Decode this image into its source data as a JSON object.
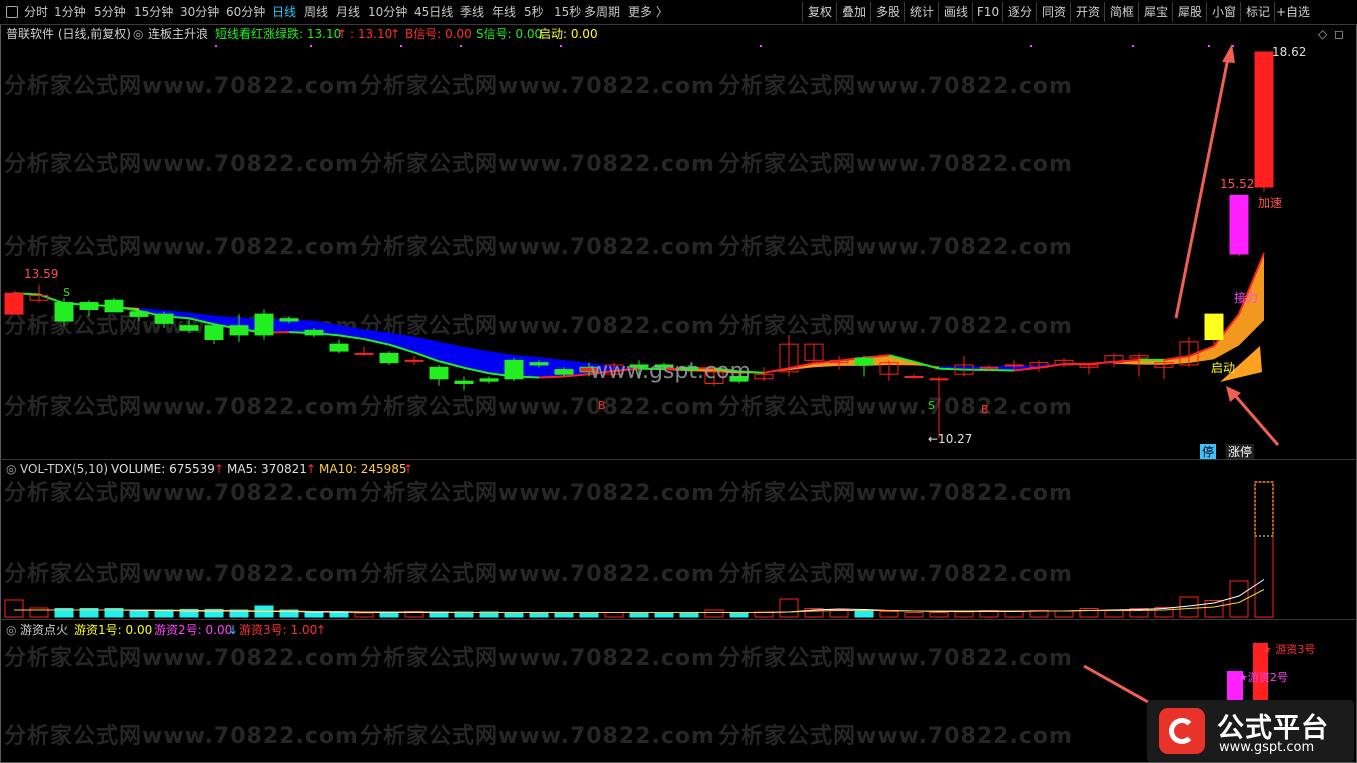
{
  "toolbar": {
    "periods": [
      "分时",
      "1分钟",
      "5分钟",
      "15分钟",
      "30分钟",
      "60分钟",
      "日线",
      "周线",
      "月线",
      "10分钟",
      "45日线",
      "季线",
      "年线",
      "5秒",
      "15秒",
      "多周期",
      "更多 〉"
    ],
    "active_period": "日线",
    "right_buttons": [
      "复权",
      "叠加",
      "多股",
      "统计",
      "画线",
      "F10",
      "逐分",
      "同资",
      "开资",
      "简框",
      "犀宝",
      "犀股",
      "小窗",
      "标记",
      "+自选"
    ]
  },
  "main_header": {
    "title": "普联软件 (日线,前复权)",
    "indicator": "连板主升浪",
    "item1_label": "短线看红涨绿跌: 13.10",
    "item2_label": ": 13.10",
    "b_signal": "B信号: 0.00",
    "s_signal": "S信号: 0.00",
    "start": "启动: 0.00"
  },
  "vol_header": {
    "name": "VOL-TDX(5,10)",
    "volume": "VOLUME: 675539",
    "ma5": "MA5: 370821",
    "ma10": "MA10: 245985"
  },
  "yz_header": {
    "name": "游资点火",
    "y1": "游资1号: 0.00",
    "y2": "游资2号: 0.00",
    "y3": "游资3号: 1.00"
  },
  "annotations": {
    "high_left": "13.59",
    "high_right": "18.62",
    "mid_price": "15.52",
    "low_price": "←10.27",
    "jiasu": "加速",
    "jieli": "接力",
    "qidong": "启动",
    "ting": "停",
    "zhangting": "涨停",
    "center_watermark": "www.gspt.com",
    "yz3_label": "★ 游资3号",
    "yz2_label": "★游资2号",
    "sig_s": "S",
    "sig_b": "B"
  },
  "watermark_text": "分析家公式网www.70822.com",
  "logo": {
    "name": "公式平台",
    "url": "www.gspt.com"
  },
  "colors": {
    "up": "#ff2020",
    "down": "#22ee22",
    "vol_down": "#20f0f0",
    "blue_band": "#0000ff",
    "orange_band": "#ffa020",
    "yellow": "#ffff20",
    "magenta": "#ff20ff",
    "accent": "#20c8ff"
  },
  "chart_data": {
    "type": "candlestick",
    "price_range": [
      10.27,
      18.62
    ],
    "candles": [
      {
        "o": 12.95,
        "h": 13.45,
        "l": 12.95,
        "c": 13.4
      },
      {
        "o": 13.25,
        "h": 13.59,
        "l": 13.2,
        "c": 13.35
      },
      {
        "o": 13.2,
        "h": 13.3,
        "l": 12.7,
        "c": 12.8
      },
      {
        "o": 13.2,
        "h": 13.25,
        "l": 12.9,
        "c": 13.05
      },
      {
        "o": 13.25,
        "h": 13.3,
        "l": 13.0,
        "c": 13.0
      },
      {
        "o": 13.0,
        "h": 13.05,
        "l": 12.8,
        "c": 12.9
      },
      {
        "o": 12.95,
        "h": 13.0,
        "l": 12.65,
        "c": 12.75
      },
      {
        "o": 12.7,
        "h": 12.85,
        "l": 12.55,
        "c": 12.6
      },
      {
        "o": 12.7,
        "h": 12.75,
        "l": 12.3,
        "c": 12.4
      },
      {
        "o": 12.7,
        "h": 12.95,
        "l": 12.35,
        "c": 12.5
      },
      {
        "o": 12.95,
        "h": 13.05,
        "l": 12.4,
        "c": 12.5
      },
      {
        "o": 12.85,
        "h": 12.9,
        "l": 12.75,
        "c": 12.8
      },
      {
        "o": 12.6,
        "h": 12.65,
        "l": 12.45,
        "c": 12.5
      },
      {
        "o": 12.3,
        "h": 12.4,
        "l": 12.1,
        "c": 12.15
      },
      {
        "o": 12.1,
        "h": 12.25,
        "l": 12.05,
        "c": 12.1
      },
      {
        "o": 12.1,
        "h": 12.15,
        "l": 11.85,
        "c": 11.9
      },
      {
        "o": 11.95,
        "h": 12.05,
        "l": 11.85,
        "c": 11.95
      },
      {
        "o": 11.8,
        "h": 11.85,
        "l": 11.4,
        "c": 11.55
      },
      {
        "o": 11.5,
        "h": 11.6,
        "l": 11.3,
        "c": 11.45
      },
      {
        "o": 11.55,
        "h": 11.6,
        "l": 11.45,
        "c": 11.5
      },
      {
        "o": 11.95,
        "h": 12.0,
        "l": 11.5,
        "c": 11.55
      },
      {
        "o": 11.9,
        "h": 11.95,
        "l": 11.8,
        "c": 11.85
      },
      {
        "o": 11.75,
        "h": 11.8,
        "l": 11.6,
        "c": 11.65
      },
      {
        "o": 11.8,
        "h": 11.9,
        "l": 11.6,
        "c": 11.7
      },
      {
        "o": 11.65,
        "h": 11.9,
        "l": 11.6,
        "c": 11.85
      },
      {
        "o": 11.85,
        "h": 11.95,
        "l": 11.55,
        "c": 11.8
      },
      {
        "o": 11.85,
        "h": 11.9,
        "l": 11.75,
        "c": 11.8
      },
      {
        "o": 11.8,
        "h": 11.85,
        "l": 11.7,
        "c": 11.75
      },
      {
        "o": 11.45,
        "h": 11.75,
        "l": 11.4,
        "c": 11.7
      },
      {
        "o": 11.6,
        "h": 11.65,
        "l": 11.45,
        "c": 11.5
      },
      {
        "o": 11.55,
        "h": 11.8,
        "l": 11.5,
        "c": 11.65
      },
      {
        "o": 11.7,
        "h": 12.5,
        "l": 11.6,
        "c": 12.3
      },
      {
        "o": 11.95,
        "h": 12.3,
        "l": 11.9,
        "c": 12.3
      },
      {
        "o": 11.9,
        "h": 12.05,
        "l": 11.75,
        "c": 11.95
      },
      {
        "o": 12.0,
        "h": 12.05,
        "l": 11.6,
        "c": 11.85
      },
      {
        "o": 11.65,
        "h": 11.95,
        "l": 11.5,
        "c": 11.9
      },
      {
        "o": 11.6,
        "h": 11.65,
        "l": 11.55,
        "c": 11.6
      },
      {
        "o": 11.55,
        "h": 11.6,
        "l": 10.27,
        "c": 11.55
      },
      {
        "o": 11.65,
        "h": 12.05,
        "l": 11.6,
        "c": 11.85
      },
      {
        "o": 11.8,
        "h": 11.85,
        "l": 11.7,
        "c": 11.8
      },
      {
        "o": 11.85,
        "h": 11.95,
        "l": 11.75,
        "c": 11.85
      },
      {
        "o": 11.8,
        "h": 11.95,
        "l": 11.7,
        "c": 11.9
      },
      {
        "o": 11.85,
        "h": 12.0,
        "l": 11.8,
        "c": 11.95
      },
      {
        "o": 11.8,
        "h": 11.9,
        "l": 11.65,
        "c": 11.85
      },
      {
        "o": 11.9,
        "h": 12.1,
        "l": 11.8,
        "c": 12.05
      },
      {
        "o": 12.0,
        "h": 12.1,
        "l": 11.6,
        "c": 12.05
      },
      {
        "o": 11.8,
        "h": 11.95,
        "l": 11.55,
        "c": 11.9
      },
      {
        "o": 11.85,
        "h": 12.45,
        "l": 11.8,
        "c": 12.35
      },
      {
        "o": 12.4,
        "h": 12.95,
        "l": 12.3,
        "c": 12.95
      },
      {
        "o": 14.25,
        "h": 15.52,
        "l": 14.2,
        "c": 15.52
      },
      {
        "o": 15.7,
        "h": 18.62,
        "l": 15.6,
        "c": 18.62
      }
    ],
    "volumes": [
      34,
      18,
      17,
      17,
      17,
      14,
      14,
      15,
      15,
      14,
      22,
      14,
      11,
      9,
      8,
      9,
      11,
      10,
      10,
      10,
      9,
      9,
      9,
      9,
      9,
      9,
      8,
      9,
      14,
      9,
      10,
      36,
      17,
      14,
      13,
      11,
      9,
      9,
      10,
      13,
      11,
      13,
      12,
      17,
      14,
      17,
      19,
      40,
      33,
      72,
      270
    ],
    "vol_ma5": [
      14,
      14,
      14,
      14,
      14,
      13,
      13,
      12,
      12,
      12,
      11,
      11,
      10,
      10,
      9,
      9,
      9,
      9,
      9,
      9,
      9,
      9,
      9,
      9,
      9,
      9,
      9,
      9,
      9,
      9,
      9,
      10,
      14,
      16,
      15,
      13,
      12,
      11,
      11,
      11,
      11,
      12,
      12,
      13,
      14,
      15,
      17,
      22,
      28,
      42,
      75
    ],
    "vol_ma10": [
      14,
      14,
      14,
      14,
      14,
      14,
      14,
      13,
      13,
      13,
      12,
      12,
      11,
      11,
      10,
      10,
      10,
      10,
      9,
      9,
      9,
      9,
      9,
      9,
      9,
      9,
      9,
      9,
      9,
      9,
      9,
      10,
      12,
      13,
      13,
      13,
      12,
      12,
      12,
      12,
      12,
      12,
      12,
      13,
      13,
      13,
      14,
      17,
      20,
      29,
      55
    ]
  }
}
